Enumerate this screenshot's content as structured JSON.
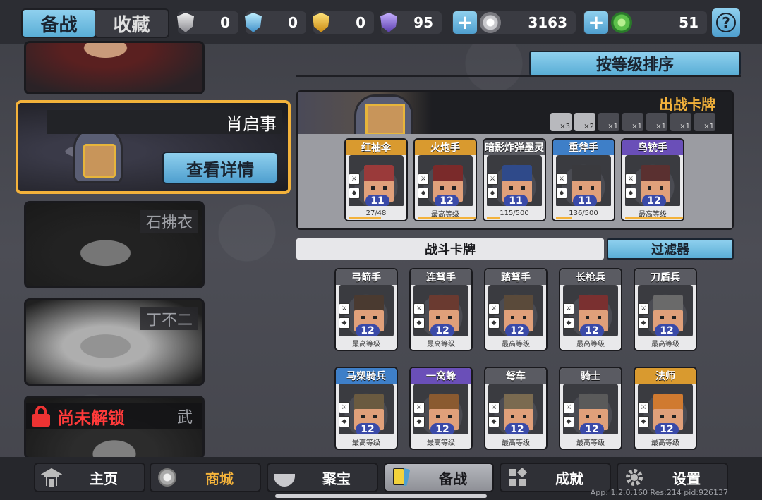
{
  "top_tabs": {
    "prepare": "备战",
    "collection": "收藏"
  },
  "resources": {
    "silver_shield": "0",
    "blue_shield": "0",
    "gold_shield": "0",
    "purple_shield": "95",
    "coins": "3163",
    "gems": "51"
  },
  "colors": {
    "accent": "#5aaed6",
    "gold": "#f3b23b",
    "lock": "#ff3a3a",
    "level": "#3a4aa8"
  },
  "heroes": [
    {
      "name": "",
      "state": "partial"
    },
    {
      "name": "肖启事",
      "state": "selected",
      "action": "查看详情"
    },
    {
      "name": "石拂衣",
      "state": "dim"
    },
    {
      "name": "丁不二",
      "state": "dim"
    },
    {
      "name": "武",
      "state": "locked",
      "lock_label": "尚未解锁"
    }
  ],
  "sort_button": "按等级排序",
  "deploy_panel": {
    "title": "出战卡牌",
    "slots": [
      "×3",
      "×2",
      "×1",
      "×1",
      "×1",
      "×1",
      "×1"
    ],
    "cards": [
      {
        "name": "红袖伞",
        "level": "11",
        "progress": "27/48",
        "tier": "gold",
        "fill": 0.56
      },
      {
        "name": "火炮手",
        "level": "12",
        "progress": "最高等级",
        "tier": "gold",
        "fill": 1
      },
      {
        "name": "暗影炸弹墨灵",
        "level": "11",
        "progress": "115/500",
        "tier": "grey",
        "fill": 0.23
      },
      {
        "name": "重斧手",
        "level": "11",
        "progress": "136/500",
        "tier": "blue",
        "fill": 0.27
      },
      {
        "name": "鸟铳手",
        "level": "12",
        "progress": "最高等级",
        "tier": "purple",
        "fill": 1
      }
    ]
  },
  "battle_cards_label": "战斗卡牌",
  "filter_button": "过滤器",
  "battle_cards": [
    {
      "name": "弓箭手",
      "level": "12",
      "progress": "最高等级",
      "tier": "grey"
    },
    {
      "name": "连弩手",
      "level": "12",
      "progress": "最高等级",
      "tier": "grey"
    },
    {
      "name": "踏弩手",
      "level": "12",
      "progress": "最高等级",
      "tier": "grey"
    },
    {
      "name": "长枪兵",
      "level": "12",
      "progress": "最高等级",
      "tier": "grey"
    },
    {
      "name": "刀盾兵",
      "level": "12",
      "progress": "最高等级",
      "tier": "grey"
    },
    {
      "name": "马槊骑兵",
      "level": "12",
      "progress": "最高等级",
      "tier": "blue"
    },
    {
      "name": "一窝蜂",
      "level": "12",
      "progress": "最高等级",
      "tier": "purple"
    },
    {
      "name": "弩车",
      "level": "12",
      "progress": "最高等级",
      "tier": "grey"
    },
    {
      "name": "骑士",
      "level": "12",
      "progress": "最高等级",
      "tier": "grey"
    },
    {
      "name": "法师",
      "level": "12",
      "progress": "最高等级",
      "tier": "gold"
    }
  ],
  "bottom_nav": [
    "主页",
    "商城",
    "聚宝",
    "备战",
    "成就",
    "设置"
  ],
  "version_text": "App: 1.2.0.160 Res:214 pid:926137"
}
